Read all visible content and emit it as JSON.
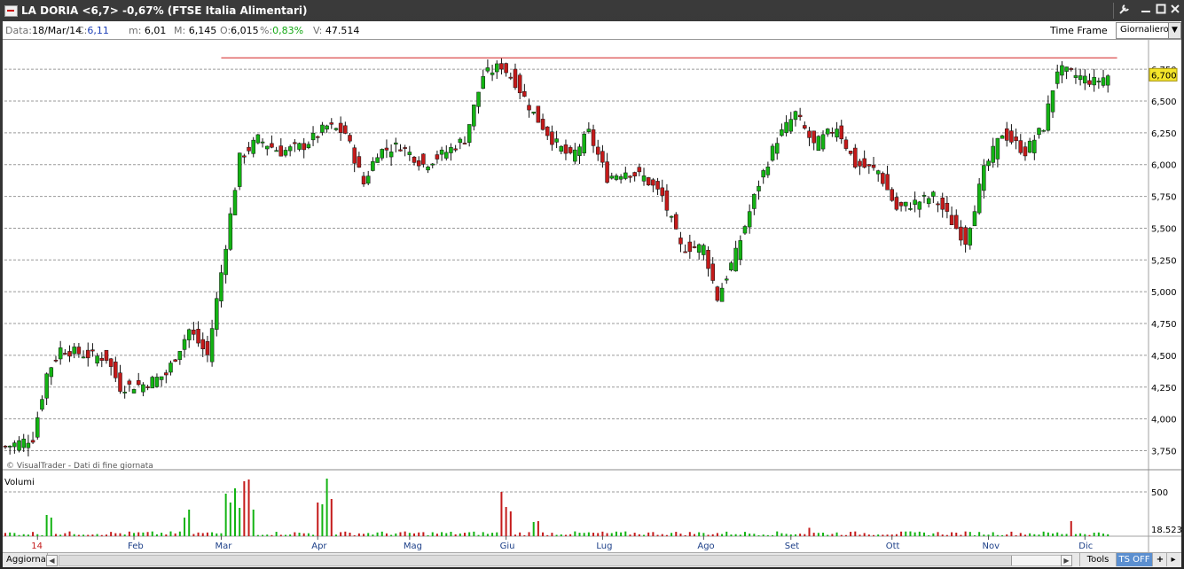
{
  "window": {
    "title": "LA DORIA <6,7> -0,67%  (FTSE Italia Alimentari)",
    "buttons": [
      "wrench",
      "minimize",
      "maximize",
      "close"
    ]
  },
  "info": {
    "data_label": "Data:",
    "data": "18/Mar/14",
    "c_label": "C:",
    "c": "6,11",
    "m_label": "m:",
    "m": "6,01",
    "M_label": "M:",
    "M": "6,145",
    "o_label": "O:",
    "o": "6,015",
    "pct_label": "%:",
    "pct": "0,83%",
    "v_label": "V:",
    "v": "47.514",
    "timeframe_label": "Time Frame",
    "timeframe_value": "Giornaliero"
  },
  "colors": {
    "up": "#13b313",
    "down": "#c41a1a",
    "resistance": "#d42020",
    "last_badge": "#f5e62a"
  },
  "bottom": {
    "aggiorna": "Aggiorna",
    "tools": "Tools",
    "tsoff": "TS OFF",
    "plus": "+"
  },
  "chart_data": {
    "type": "candlestick",
    "watermark": "© VisualTrader - Dati di fine giornata",
    "price_ticks": [
      "6,750",
      "6,500",
      "6,250",
      "6,000",
      "5,750",
      "5,500",
      "5,250",
      "5,000",
      "4,750",
      "4,500",
      "4,250",
      "4,000",
      "3,750"
    ],
    "price_tick_values": [
      6.75,
      6.5,
      6.25,
      6.0,
      5.75,
      5.5,
      5.25,
      5.0,
      4.75,
      4.5,
      4.25,
      4.0,
      3.75
    ],
    "ylim": [
      3.6,
      6.96
    ],
    "last_price_label": "6,700",
    "last_price": 6.7,
    "resistance_level": 6.84,
    "volume_label": "Volumi",
    "volume_tick": "500",
    "volume_tick_value": 500,
    "volume_last_label": "18.523",
    "volume_max": 650,
    "months": [
      "14",
      "Feb",
      "Mar",
      "Apr",
      "Mag",
      "Giu",
      "Lug",
      "Ago",
      "Set",
      "Ott",
      "Nov",
      "Dic"
    ],
    "months_first_is_year": true,
    "anchors": [
      [
        0,
        3.78
      ],
      [
        6,
        3.85
      ],
      [
        9,
        4.35
      ],
      [
        12,
        4.55
      ],
      [
        18,
        4.5
      ],
      [
        22,
        4.48
      ],
      [
        25,
        4.25
      ],
      [
        30,
        4.27
      ],
      [
        35,
        4.35
      ],
      [
        40,
        4.7
      ],
      [
        44,
        4.5
      ],
      [
        47,
        5.15
      ],
      [
        51,
        6.05
      ],
      [
        55,
        6.2
      ],
      [
        60,
        6.1
      ],
      [
        65,
        6.15
      ],
      [
        70,
        6.3
      ],
      [
        74,
        6.25
      ],
      [
        78,
        5.85
      ],
      [
        81,
        6.1
      ],
      [
        86,
        6.15
      ],
      [
        91,
        6.0
      ],
      [
        96,
        6.1
      ],
      [
        100,
        6.2
      ],
      [
        104,
        6.7
      ],
      [
        108,
        6.78
      ],
      [
        111,
        6.65
      ],
      [
        115,
        6.4
      ],
      [
        119,
        6.2
      ],
      [
        123,
        6.05
      ],
      [
        127,
        6.25
      ],
      [
        131,
        5.9
      ],
      [
        135,
        5.95
      ],
      [
        139,
        5.9
      ],
      [
        143,
        5.75
      ],
      [
        147,
        5.35
      ],
      [
        152,
        5.35
      ],
      [
        155,
        4.95
      ],
      [
        159,
        5.3
      ],
      [
        164,
        5.85
      ],
      [
        168,
        6.2
      ],
      [
        172,
        6.4
      ],
      [
        176,
        6.15
      ],
      [
        181,
        6.3
      ],
      [
        185,
        6.0
      ],
      [
        190,
        5.95
      ],
      [
        194,
        5.65
      ],
      [
        198,
        5.7
      ],
      [
        202,
        5.75
      ],
      [
        206,
        5.55
      ],
      [
        209,
        5.4
      ],
      [
        213,
        5.95
      ],
      [
        217,
        6.25
      ],
      [
        222,
        6.1
      ],
      [
        226,
        6.3
      ],
      [
        229,
        6.75
      ],
      [
        233,
        6.7
      ],
      [
        237,
        6.65
      ],
      [
        240,
        6.7
      ]
    ],
    "bars": 241,
    "volume_spikes": [
      [
        48,
        480
      ],
      [
        49,
        380
      ],
      [
        50,
        540
      ],
      [
        51,
        320
      ],
      [
        52,
        620
      ],
      [
        53,
        640
      ],
      [
        54,
        300
      ],
      [
        68,
        380
      ],
      [
        69,
        360
      ],
      [
        70,
        650
      ],
      [
        71,
        420
      ],
      [
        108,
        500
      ],
      [
        109,
        330
      ],
      [
        110,
        280
      ],
      [
        175,
        95
      ],
      [
        232,
        170
      ],
      [
        9,
        240
      ],
      [
        10,
        210
      ],
      [
        40,
        300
      ],
      [
        39,
        210
      ],
      [
        115,
        160
      ],
      [
        116,
        170
      ]
    ]
  }
}
